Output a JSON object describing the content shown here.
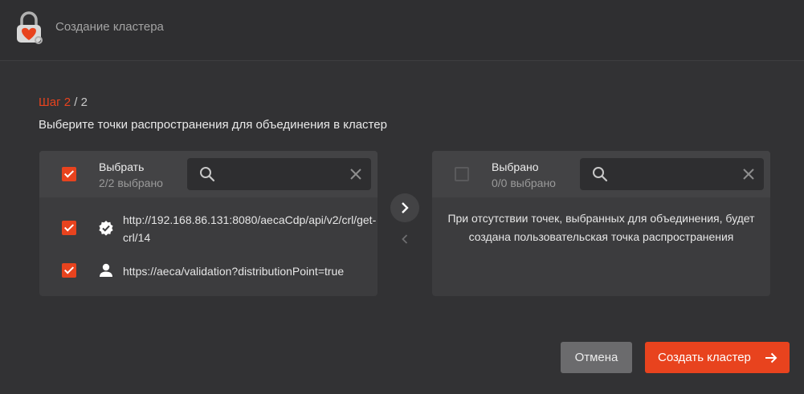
{
  "header": {
    "title": "Создание кластера",
    "logo_icon": "lock-logo-icon"
  },
  "step": {
    "label": "Шаг",
    "current": "2",
    "separator": "/ 2"
  },
  "subtitle": "Выберите точки распространения для объединения в кластер",
  "source_panel": {
    "title": "Выбрать",
    "count": "2/2 выбрано",
    "select_all_checked": true,
    "search": {
      "value": "",
      "placeholder": ""
    },
    "items": [
      {
        "text": "http://192.168.86.131:8080/aecaCdp/api/v2/crl/get-crl/14",
        "icon": "verified-badge-icon",
        "checked": true
      },
      {
        "text": "https://aeca/validation?distributionPoint=true",
        "icon": "user-icon",
        "checked": true
      }
    ]
  },
  "target_panel": {
    "title": "Выбрано",
    "count": "0/0 выбрано",
    "select_all_checked": false,
    "search": {
      "value": "",
      "placeholder": ""
    },
    "empty_message": "При отсутствии точек, выбранных для объединения, будет создана пользовательская точка распространения"
  },
  "actions": {
    "cancel_label": "Отмена",
    "create_label": "Создать кластер"
  },
  "colors": {
    "accent": "#e8431e",
    "background": "#323234",
    "panel": "#3c3c3e"
  }
}
